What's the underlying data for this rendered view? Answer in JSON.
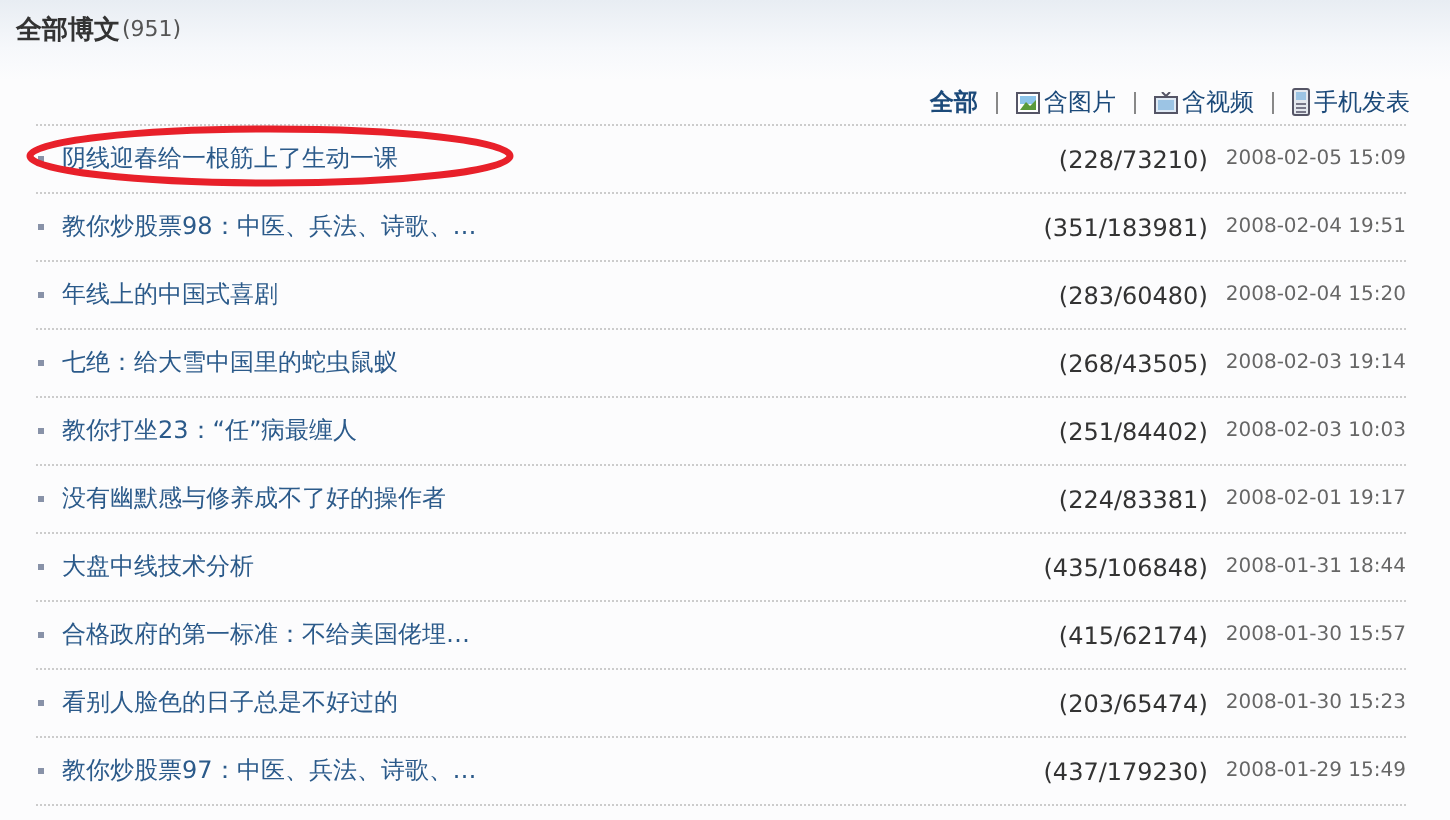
{
  "header": {
    "title": "全部博文",
    "count": "(951)"
  },
  "filters": [
    {
      "label": "全部",
      "selected": true,
      "kind": "text"
    },
    {
      "label": "含图片",
      "selected": false,
      "kind": "picture"
    },
    {
      "label": "含视频",
      "selected": false,
      "kind": "tv"
    },
    {
      "label": "手机发表",
      "selected": false,
      "kind": "phone"
    }
  ],
  "rows": [
    {
      "title": "阴线迎春给一根筋上了生动一课",
      "stats": "(228/73210)",
      "date": "2008-02-05 15:09",
      "highlighted": true
    },
    {
      "title": "教你炒股票98：中医、兵法、诗歌、…",
      "stats": "(351/183981)",
      "date": "2008-02-04 19:51",
      "highlighted": false
    },
    {
      "title": "年线上的中国式喜剧",
      "stats": "(283/60480)",
      "date": "2008-02-04 15:20",
      "highlighted": false
    },
    {
      "title": "七绝：给大雪中国里的蛇虫鼠蚁",
      "stats": "(268/43505)",
      "date": "2008-02-03 19:14",
      "highlighted": false
    },
    {
      "title": "教你打坐23：“任”病最缠人",
      "stats": "(251/84402)",
      "date": "2008-02-03 10:03",
      "highlighted": false
    },
    {
      "title": "没有幽默感与修养成不了好的操作者",
      "stats": "(224/83381)",
      "date": "2008-02-01 19:17",
      "highlighted": false
    },
    {
      "title": "大盘中线技术分析",
      "stats": "(435/106848)",
      "date": "2008-01-31 18:44",
      "highlighted": false
    },
    {
      "title": "合格政府的第一标准：不给美国佬埋…",
      "stats": "(415/62174)",
      "date": "2008-01-30 15:57",
      "highlighted": false
    },
    {
      "title": "看别人脸色的日子总是不好过的",
      "stats": "(203/65474)",
      "date": "2008-01-30 15:23",
      "highlighted": false
    },
    {
      "title": "教你炒股票97：中医、兵法、诗歌、…",
      "stats": "(437/179230)",
      "date": "2008-01-29 15:49",
      "highlighted": false
    }
  ]
}
